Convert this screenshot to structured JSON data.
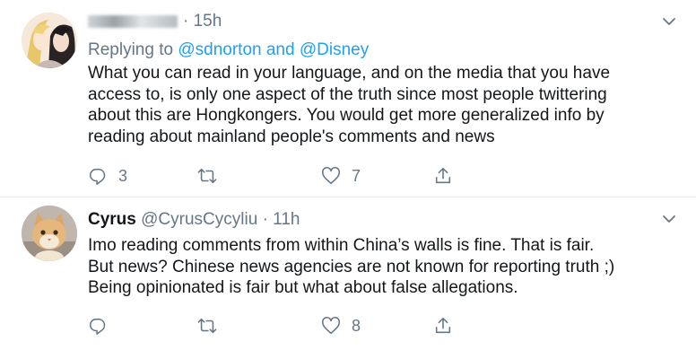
{
  "tweets": [
    {
      "name": "",
      "name_obscured": true,
      "separator": "·",
      "time": "15h",
      "reply_prefix": "Replying to ",
      "reply_to_1": "@sdnorton",
      "reply_joiner": " and ",
      "reply_to_2": "@Disney",
      "text_lines": [
        "What you can read in your language, and on the media that you have",
        "access to, is only one aspect of the truth since most people twittering",
        "about this are Hongkongers. You would get more generalized info by",
        "reading about mainland people's comments and news"
      ],
      "replies": "3",
      "retweets": "",
      "likes": "7"
    },
    {
      "name": "Cyrus",
      "handle": "@CyrusCycyliu",
      "separator": "·",
      "time": "11h",
      "text_lines": [
        "Imo reading comments from within China’s walls is fine. That is fair.",
        "But news? Chinese news agencies are not known for reporting truth ;)",
        "Being opinionated is fair but what about false allegations."
      ],
      "replies": "",
      "retweets": "",
      "likes": "8"
    }
  ],
  "icons": {
    "reply": "reply-icon",
    "retweet": "retweet-icon",
    "like": "like-icon",
    "share": "share-icon",
    "more": "chevron-down-icon"
  },
  "colors": {
    "text": "#14171a",
    "muted": "#657786",
    "link": "#1da1f2",
    "divider": "#e6ecf0"
  }
}
